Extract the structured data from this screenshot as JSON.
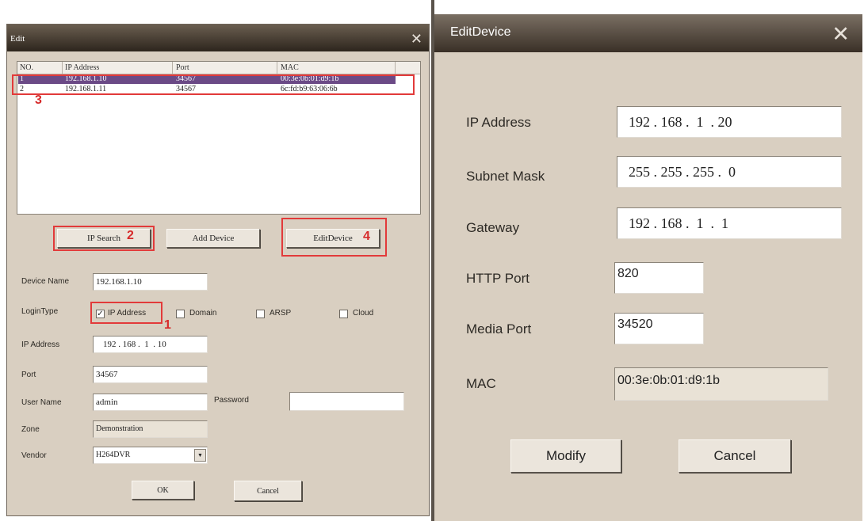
{
  "edit_window": {
    "title": "Edit",
    "close_glyph": "✕",
    "table": {
      "columns": [
        "NO.",
        "IP Address",
        "Port",
        "MAC"
      ],
      "rows": [
        {
          "no": "1",
          "ip": "192.168.1.10",
          "port": "34567",
          "mac": "00:3e:0b:01:d9:1b"
        },
        {
          "no": "2",
          "ip": "192.168.1.11",
          "port": "34567",
          "mac": "6c:fd:b9:63:06:6b"
        }
      ]
    },
    "buttons": {
      "ip_search": "IP Search",
      "add_device": "Add Device",
      "edit_device": "EditDevice",
      "ok": "OK",
      "cancel": "Cancel"
    },
    "labels": {
      "device_name": "Device Name",
      "login_type": "LoginType",
      "ip_address": "IP Address",
      "port": "Port",
      "user_name": "User Name",
      "password": "Password",
      "zone": "Zone",
      "vendor": "Vendor"
    },
    "login_options": {
      "ip_address": "IP Address",
      "domain": "Domain",
      "arsp": "ARSP",
      "cloud": "Cloud"
    },
    "login_checked": "IP Address",
    "values": {
      "device_name": "192.168.1.10",
      "ip_address": "192 . 168 .  1  . 10",
      "port": "34567",
      "user_name": "admin",
      "password": "",
      "zone": "Demonstration",
      "vendor": "H264DVR"
    },
    "check_glyph": "✓",
    "dropdown_glyph": "▼"
  },
  "annotations": {
    "n1": "1",
    "n2": "2",
    "n3": "3",
    "n4": "4"
  },
  "edit_device_window": {
    "title": "EditDevice",
    "close_glyph": "✕",
    "labels": {
      "ip_address": "IP Address",
      "subnet_mask": "Subnet Mask",
      "gateway": "Gateway",
      "http_port": "HTTP Port",
      "media_port": "Media Port",
      "mac": "MAC"
    },
    "values": {
      "ip_address": "192 . 168 .  1  . 20",
      "subnet_mask": "255 . 255 . 255 .  0",
      "gateway": "192 . 168 .  1  .  1",
      "http_port": "820",
      "media_port": "34520",
      "mac": "00:3e:0b:01:d9:1b"
    },
    "buttons": {
      "modify": "Modify",
      "cancel": "Cancel"
    }
  },
  "colors": {
    "selected_row": "#6b4a86",
    "annotation_red": "#e23a3a",
    "window_body": "#d9cfc1"
  }
}
